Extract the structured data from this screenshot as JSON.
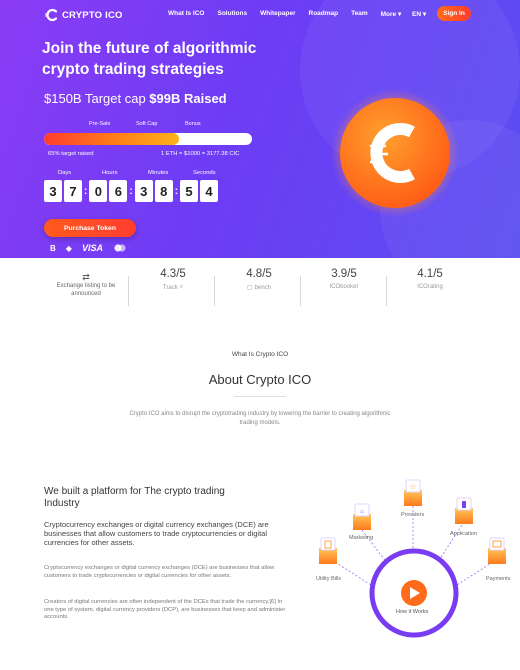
{
  "nav": {
    "brand": "CRYPTO ICO",
    "links": [
      "What Is ICO",
      "Solutions",
      "Whitepaper",
      "Roadmap",
      "Team",
      "More ▾"
    ],
    "lang": "EN ▾",
    "signin": "Sign In"
  },
  "hero": {
    "headline": "Join the future of algorithmic crypto trading strategies",
    "target_cap": "$150B Target cap",
    "raised": "$99B Raised",
    "markers": [
      "Pre-Sale",
      "Soft Cap",
      "Bonus"
    ],
    "progress_percent": 65,
    "progress_label": "65% target raised",
    "rate": "1 ETH = $1000 = 3177.38 CIC",
    "countdown": {
      "labels": [
        "Days",
        "Hours",
        "Minutes",
        "Seconds"
      ],
      "digits": [
        "3",
        "7",
        "0",
        "6",
        "3",
        "8",
        "5",
        "4"
      ]
    },
    "purchase": "Purchase Token",
    "payments": [
      "B",
      "◆",
      "VISA"
    ],
    "coin_letter": "C"
  },
  "ratings": {
    "exchange": "Exchange listing to be announced",
    "items": [
      {
        "score": "4.3/5",
        "source": "Track"
      },
      {
        "score": "4.8/5",
        "source": "bench"
      },
      {
        "score": "3.9/5",
        "source": "ICObooker"
      },
      {
        "score": "4.1/5",
        "source": "ICOrating"
      }
    ]
  },
  "about": {
    "kicker": "What Is Crypto ICO",
    "title": "About Crypto ICO",
    "desc": "Crypto ICO aims to disrupt the cryptotrading industry by lowering the barrier to creating algorithmic trading models."
  },
  "platform": {
    "title": "We built a platform for The crypto trading Industry",
    "lead": "Cryptocurrency exchanges or digital currency exchanges (DCE) are businesses that allow customers to trade cryptocurrencies or digital currencies for other assets.",
    "p1": "Cryptocurrency exchanges or digital currency exchanges (DCE) are businesses that allow customers to trade cryptocurrencies or digital currencies for other assets.",
    "p2": "Creators of digital currencies are often independent of the DCEs that trade the currency.[6] In one type of system, digital currency providers (DCP), are businesses that keep and administer accounts."
  },
  "diagram": {
    "nodes": [
      "Providers",
      "Marketing",
      "Application",
      "Utility Bills",
      "Payments"
    ],
    "center": "How it Works"
  },
  "colors": {
    "hero_start": "#8a3cf4",
    "hero_end": "#5a4ef2",
    "accent_orange": "#ff6b1a",
    "accent_red": "#ff3d2e",
    "ring_purple": "#7a3cf0"
  }
}
